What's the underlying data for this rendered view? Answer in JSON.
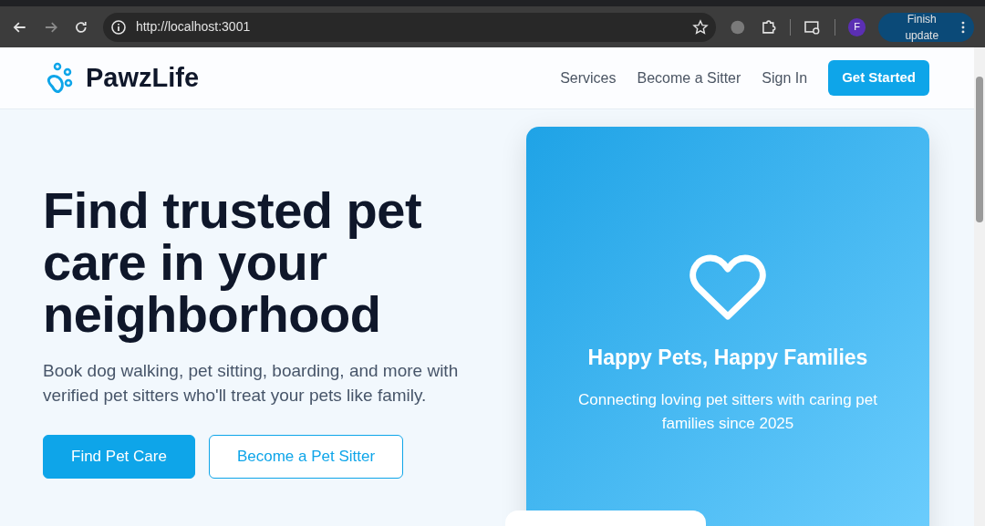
{
  "browser": {
    "url": "http://localhost:3001",
    "profile_initial": "F",
    "update_label": "Finish update"
  },
  "nav": {
    "brand": "PawzLife",
    "links": [
      "Services",
      "Become a Sitter",
      "Sign In"
    ],
    "cta": "Get Started"
  },
  "hero": {
    "heading": "Find trusted pet care in your neighborhood",
    "lead": "Book dog walking, pet sitting, boarding, and more with verified pet sitters who'll treat your pets like family.",
    "buttons": [
      {
        "label": "Find Pet Care",
        "kind": "primary"
      },
      {
        "label": "Become a Pet Sitter",
        "kind": "outline"
      }
    ]
  },
  "card": {
    "title": "Happy Pets, Happy Families",
    "text": "Connecting loving pet sitters with caring pet families since 2025"
  }
}
